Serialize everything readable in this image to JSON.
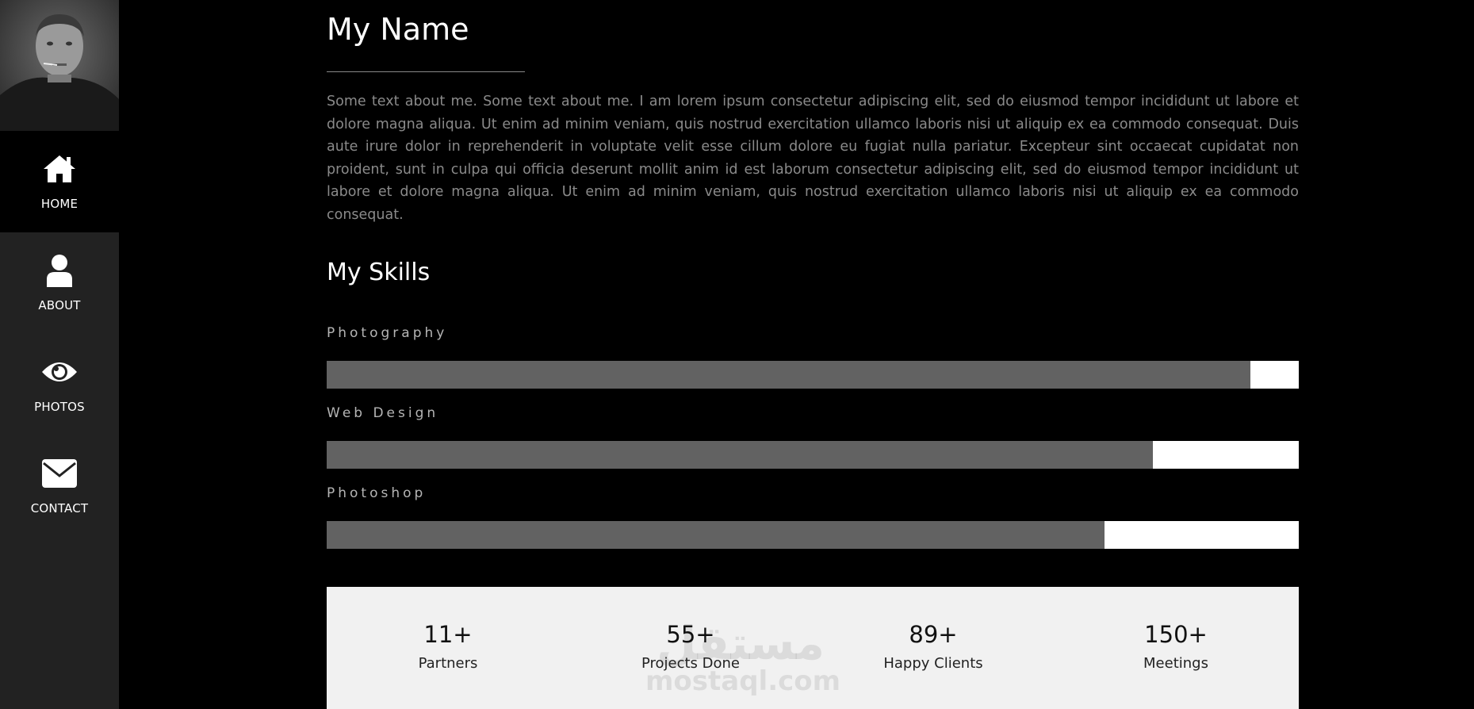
{
  "sidebar": {
    "items": [
      {
        "label": "HOME",
        "icon": "home-icon",
        "active": true
      },
      {
        "label": "ABOUT",
        "icon": "user-icon",
        "active": false
      },
      {
        "label": "PHOTOS",
        "icon": "eye-icon",
        "active": false
      },
      {
        "label": "CONTACT",
        "icon": "envelope-icon",
        "active": false
      }
    ]
  },
  "main": {
    "title": "My Name",
    "about": "Some text about me. Some text about me. I am lorem ipsum consectetur adipiscing elit, sed do eiusmod tempor incididunt ut labore et dolore magna aliqua. Ut enim ad minim veniam, quis nostrud exercitation ullamco laboris nisi ut aliquip ex ea commodo consequat. Duis aute irure dolor in reprehenderit in voluptate velit esse cillum dolore eu fugiat nulla pariatur. Excepteur sint occaecat cupidatat non proident, sunt in culpa qui officia deserunt mollit anim id est laborum consectetur adipiscing elit, sed do eiusmod tempor incididunt ut labore et dolore magna aliqua. Ut enim ad minim veniam, quis nostrud exercitation ullamco laboris nisi ut aliquip ex ea commodo consequat.",
    "skills_title": "My Skills",
    "skills": [
      {
        "name": "Photography",
        "level_percent": 95
      },
      {
        "name": "Web Design",
        "level_percent": 85
      },
      {
        "name": "Photoshop",
        "level_percent": 80
      }
    ],
    "stats": [
      {
        "value": "11+",
        "label": "Partners"
      },
      {
        "value": "55+",
        "label": "Projects Done"
      },
      {
        "value": "89+",
        "label": "Happy Clients"
      },
      {
        "value": "150+",
        "label": "Meetings"
      }
    ],
    "watermark": {
      "line1": "مستقل",
      "line2": "mostaql.com"
    }
  },
  "colors": {
    "background": "#000000",
    "sidebar": "#222222",
    "skill_fill": "#626262",
    "skill_track": "#ffffff",
    "stats_bg": "#f1f1f1"
  }
}
